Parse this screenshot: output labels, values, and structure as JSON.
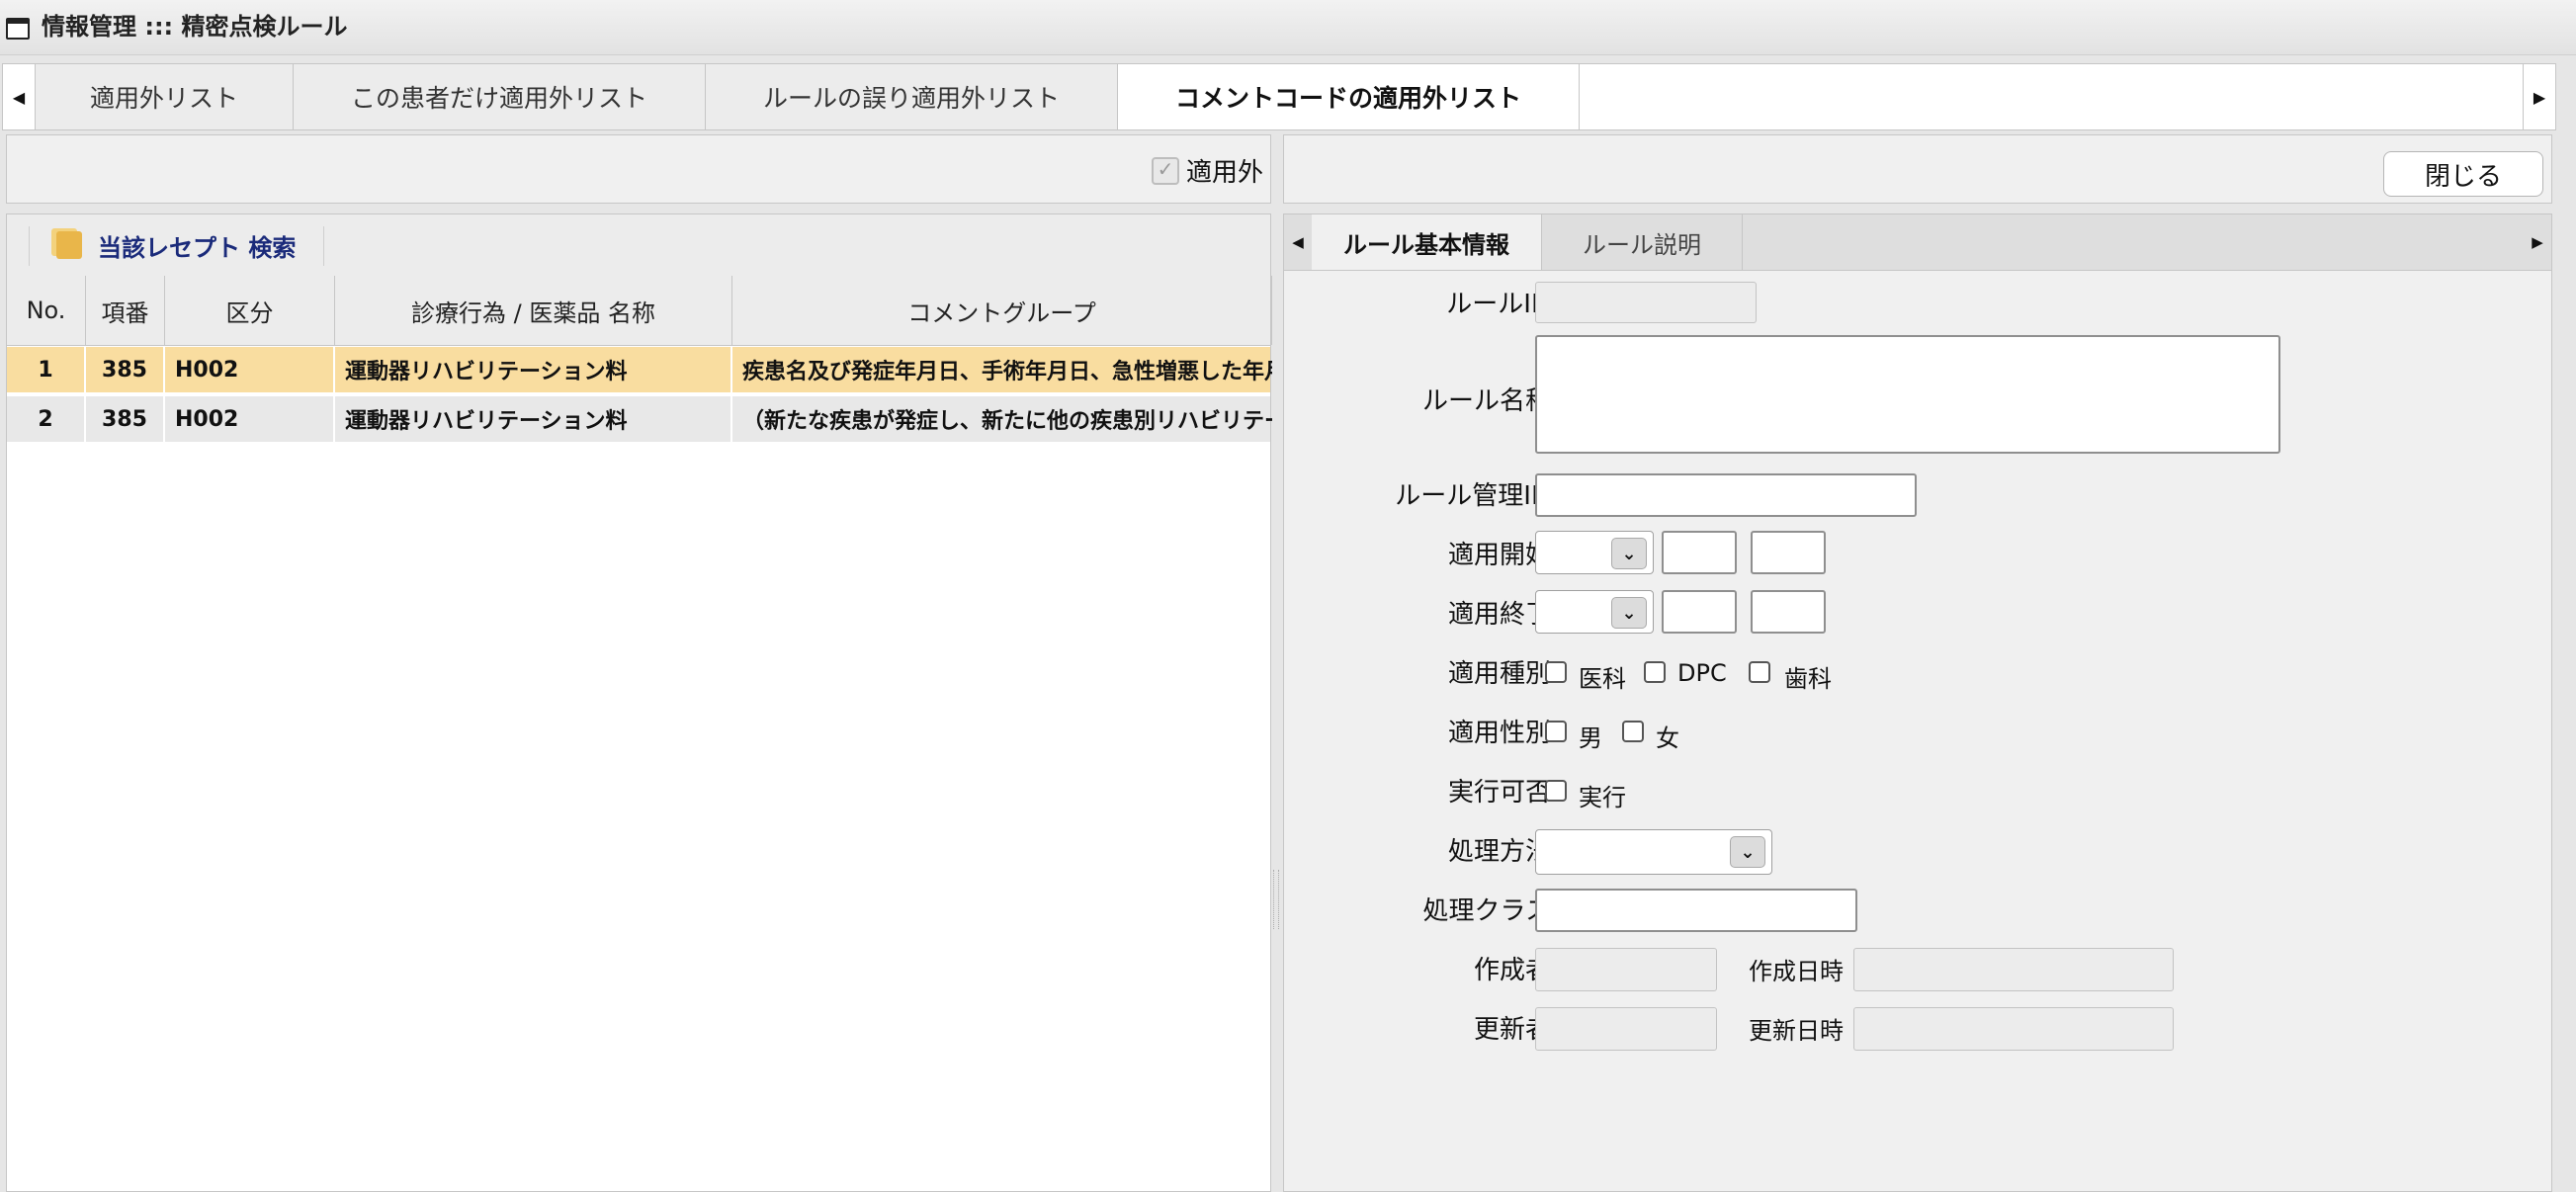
{
  "window": {
    "title": "情報管理 ::: 精密点検ルール"
  },
  "top_tabs": [
    {
      "label": "適用外リスト",
      "active": false
    },
    {
      "label": "この患者だけ適用外リスト",
      "active": false
    },
    {
      "label": "ルールの誤り適用外リスト",
      "active": false
    },
    {
      "label": "コメントコードの適用外リスト",
      "active": true
    }
  ],
  "left_toolbar": {
    "checkbox_label": "適用外",
    "checked": true
  },
  "right_toolbar": {
    "close_label": "閉じる"
  },
  "search": {
    "label": "当該レセプト 検索"
  },
  "grid": {
    "columns": [
      "No.",
      "項番",
      "区分",
      "診療行為 / 医薬品 名称",
      "コメントグループ"
    ],
    "rows": [
      {
        "no": "1",
        "item": "385",
        "kubun": "H002",
        "name": "運動器リハビリテーション料",
        "comment": "疾患名及び発症年月日、手術年月日、急性増悪した年月日"
      },
      {
        "no": "2",
        "item": "385",
        "kubun": "H002",
        "name": "運動器リハビリテーション料",
        "comment": "（新たな疾患が発症し、新たに他の疾患別リハビリテーション"
      }
    ]
  },
  "detail_tabs": [
    {
      "label": "ルール基本情報",
      "active": true
    },
    {
      "label": "ルール説明",
      "active": false
    }
  ],
  "form": {
    "rule_id_label": "ルールID",
    "rule_name_label": "ルール名称",
    "rule_mgmt_id_label": "ルール管理ID",
    "start_label": "適用開始",
    "end_label": "適用終了",
    "type_label": "適用種別",
    "type_options": [
      "医科",
      "DPC",
      "歯科"
    ],
    "gender_label": "適用性別",
    "gender_options": [
      "男",
      "女"
    ],
    "exec_label": "実行可否",
    "exec_option": "実行",
    "method_label": "処理方法",
    "class_label": "処理クラス",
    "creator_label": "作成者",
    "created_at_label": "作成日時",
    "updater_label": "更新者",
    "updated_at_label": "更新日時"
  }
}
